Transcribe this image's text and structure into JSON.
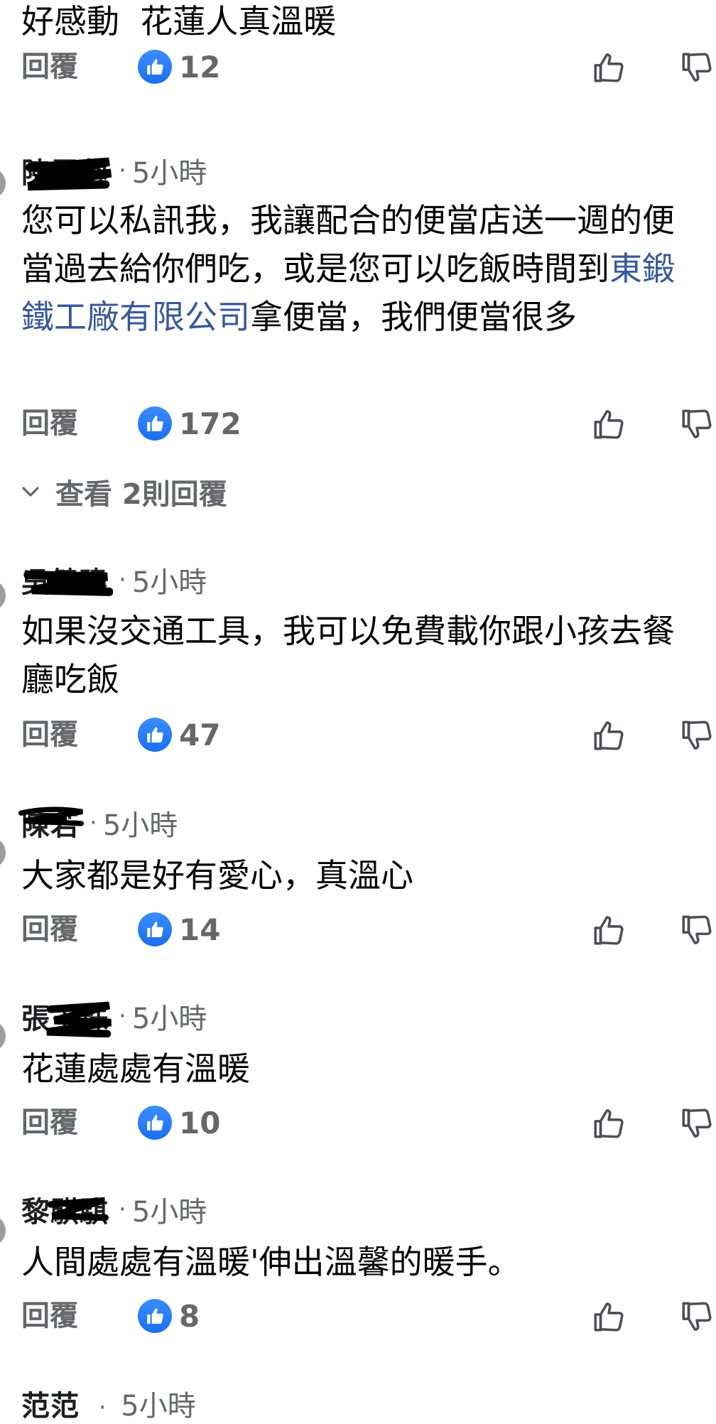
{
  "reply_label": "回覆",
  "separator": "·",
  "comments": [
    {
      "author": "",
      "time": "",
      "text": "好感動  花蓮人真溫暖",
      "likes": "12"
    },
    {
      "author": "陳雲蓉",
      "time": "5小時",
      "text_before_link": "您可以私訊我，我讓配合的便當店送一週的便當過去給你們吃，或是您可以吃飯時間到",
      "link_text": "東鍛鐵工廠有限公司",
      "text_after_link": "拿便當，我們便當很多",
      "likes": "172"
    },
    {
      "author": "吳健瑋",
      "time": "5小時",
      "text": "如果沒交通工具，我可以免費載你跟小孩去餐廳吃飯",
      "likes": "47"
    },
    {
      "author": "陳若",
      "time": "5小時",
      "text": "大家都是好有愛心，真溫心",
      "likes": "14"
    },
    {
      "author": "張玉珠",
      "time": "5小時",
      "text": "花蓮處處有溫暖",
      "likes": "10"
    },
    {
      "author": "黎騏騏",
      "time": "5小時",
      "text": "人間處處有溫暖'伸出溫馨的暖手。",
      "likes": "8"
    },
    {
      "author": "范范",
      "time": "5小時",
      "text": "",
      "likes": ""
    }
  ],
  "view_replies_label": "查看 2則回覆",
  "colors": {
    "like_blue": "#1a6ff0",
    "link": "#385898",
    "muted": "#65676b",
    "text": "#050505",
    "scribble": "#000000"
  },
  "icons": [
    "like-badge-icon",
    "thumb-up-icon",
    "thumb-down-icon",
    "chevron-down-icon"
  ]
}
